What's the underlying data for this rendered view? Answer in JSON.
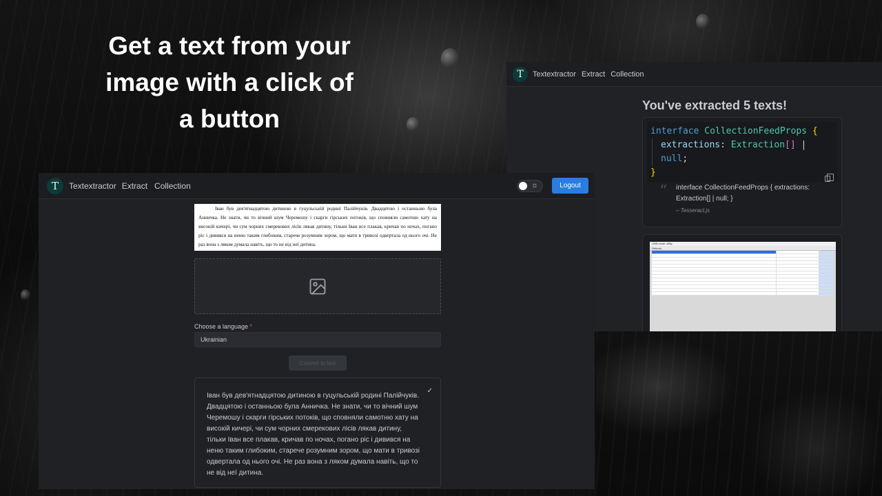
{
  "headline": "Get a text from your image with a click of a button",
  "app": {
    "brand": "Textextractor",
    "logo_glyph": "T",
    "nav": [
      "Extract",
      "Collection"
    ]
  },
  "collection": {
    "heading": "You've extracted 5 texts!",
    "code": {
      "line1_kw": "interface",
      "line1_type": "CollectionFeedProps",
      "line1_brace": "{",
      "line2_prop": "extractions",
      "line2_colon": ":",
      "line2_type": "Extraction",
      "line2_arr": "[]",
      "line2_pipe": "|",
      "line2_null": "null",
      "line2_semi": ";",
      "line3_brace": "}"
    },
    "quote_mark": "“",
    "quote_text": "interface CollectionFeedProps { extractions: Extraction[] | null; }",
    "quote_author": "– Tesseract.js",
    "thumb_title": "USB mode utility",
    "thumb_toolbar": "Refresh"
  },
  "extract": {
    "logout_label": "Logout",
    "sun_icon": "☼",
    "image_text": "Іван був дев'ятнадцятою дитиною в гуцульській родині Палійчуків. Двадцятою і останньою була Анничка. Не знати, чи то вічний шум Черемошу і скарги гірських потоків, що сповняли самотню хату на високій кичері, чи сум чорних смерекових лісів лякав дитину, тільки Іван все плакав, кричав по ночах, погано ріс і дивився на неню таким глибоким, старече розумним зором, що мати в тривозі одвертала од нього очі. Не раз вона з ляком думала навіть, що то не від неї дитина.",
    "language_label": "Choose a language",
    "language_required": "*",
    "language_value": "Ukrainian",
    "convert_label": "Convert to text",
    "check_icon": "✓",
    "result_text": "Іван був дев'ятнадцятою дитиною в гуцульській родині Палійчуків. Двадцятою і останньою була Анничка. Не знати, чи то вічний шум Черемошу і скарги гірських потоків, що сповняли самотню хату на високій кичері, чи сум чорних смерекових лісів лякав дитину, тільки Іван все плакав, кричав по ночах, погано ріс і дивився на неню таким глибоким, старече розумним зором, що мати в тривозі одвертала од нього очі. Не раз вона з ляком думала навіть, що то не від неї дитина."
  },
  "colors": {
    "accent": "#2a7de1",
    "logo_bg": "#0d3b3a",
    "panel_bg": "#1f2125"
  }
}
